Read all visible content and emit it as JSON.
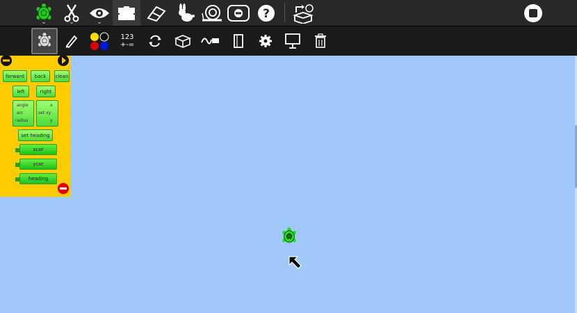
{
  "toolbar_main": {
    "items": [
      {
        "name": "turtle-palette-icon"
      },
      {
        "name": "cut-icon"
      },
      {
        "name": "eye-icon"
      },
      {
        "name": "blocks-icon"
      },
      {
        "name": "eraser-icon"
      },
      {
        "name": "rabbit-icon"
      },
      {
        "name": "snail-icon"
      },
      {
        "name": "stop-icon"
      },
      {
        "name": "help-icon"
      },
      {
        "name": "turtle-export-icon"
      },
      {
        "name": "stop-circle-icon"
      }
    ]
  },
  "toolbar_palettes": {
    "numbers_label_top": "123",
    "numbers_label_bottom": "+-="
  },
  "palette": {
    "blocks": {
      "forward": "forward",
      "back": "back",
      "clean": "clean",
      "left": "left",
      "right": "right",
      "arc": "arc",
      "arc_angle": "angle",
      "arc_radius": "radius",
      "set_xy": "set xy",
      "set_xy_x": "x",
      "set_xy_y": "y",
      "set_heading": "set heading",
      "xcor": "xcor",
      "ycor": "ycor",
      "heading": "heading"
    }
  },
  "colors": {
    "toolbar_bg": "#282828",
    "toolbar2_bg": "#1a1a1a",
    "canvas_bg": "#a0c8f8",
    "palette_bg": "#ffcc00",
    "block_green": "#4cdc3c",
    "turtle_green": "#22cc22"
  }
}
